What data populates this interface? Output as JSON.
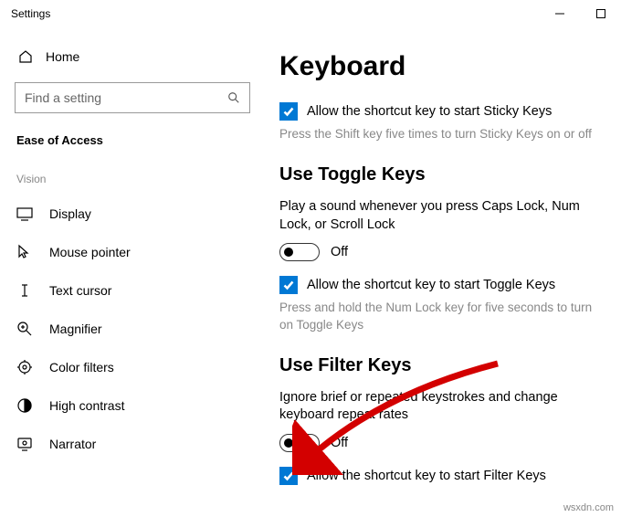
{
  "titlebar": {
    "title": "Settings"
  },
  "sidebar": {
    "home": "Home",
    "search_placeholder": "Find a setting",
    "category": "Ease of Access",
    "group": "Vision",
    "items": [
      {
        "label": "Display"
      },
      {
        "label": "Mouse pointer"
      },
      {
        "label": "Text cursor"
      },
      {
        "label": "Magnifier"
      },
      {
        "label": "Color filters"
      },
      {
        "label": "High contrast"
      },
      {
        "label": "Narrator"
      }
    ]
  },
  "content": {
    "heading": "Keyboard",
    "sticky": {
      "check": "Allow the shortcut key to start Sticky Keys",
      "desc": "Press the Shift key five times to turn Sticky Keys on or off"
    },
    "toggle_section": {
      "heading": "Use Toggle Keys",
      "body": "Play a sound whenever you press Caps Lock, Num Lock, or Scroll Lock",
      "state": "Off",
      "check": "Allow the shortcut key to start Toggle Keys",
      "desc": "Press and hold the Num Lock key for five seconds to turn on Toggle Keys"
    },
    "filter_section": {
      "heading": "Use Filter Keys",
      "body": "Ignore brief or repeated keystrokes and change keyboard repeat rates",
      "state": "Off",
      "check": "Allow the shortcut key to start Filter Keys"
    }
  },
  "watermark": "wsxdn.com"
}
